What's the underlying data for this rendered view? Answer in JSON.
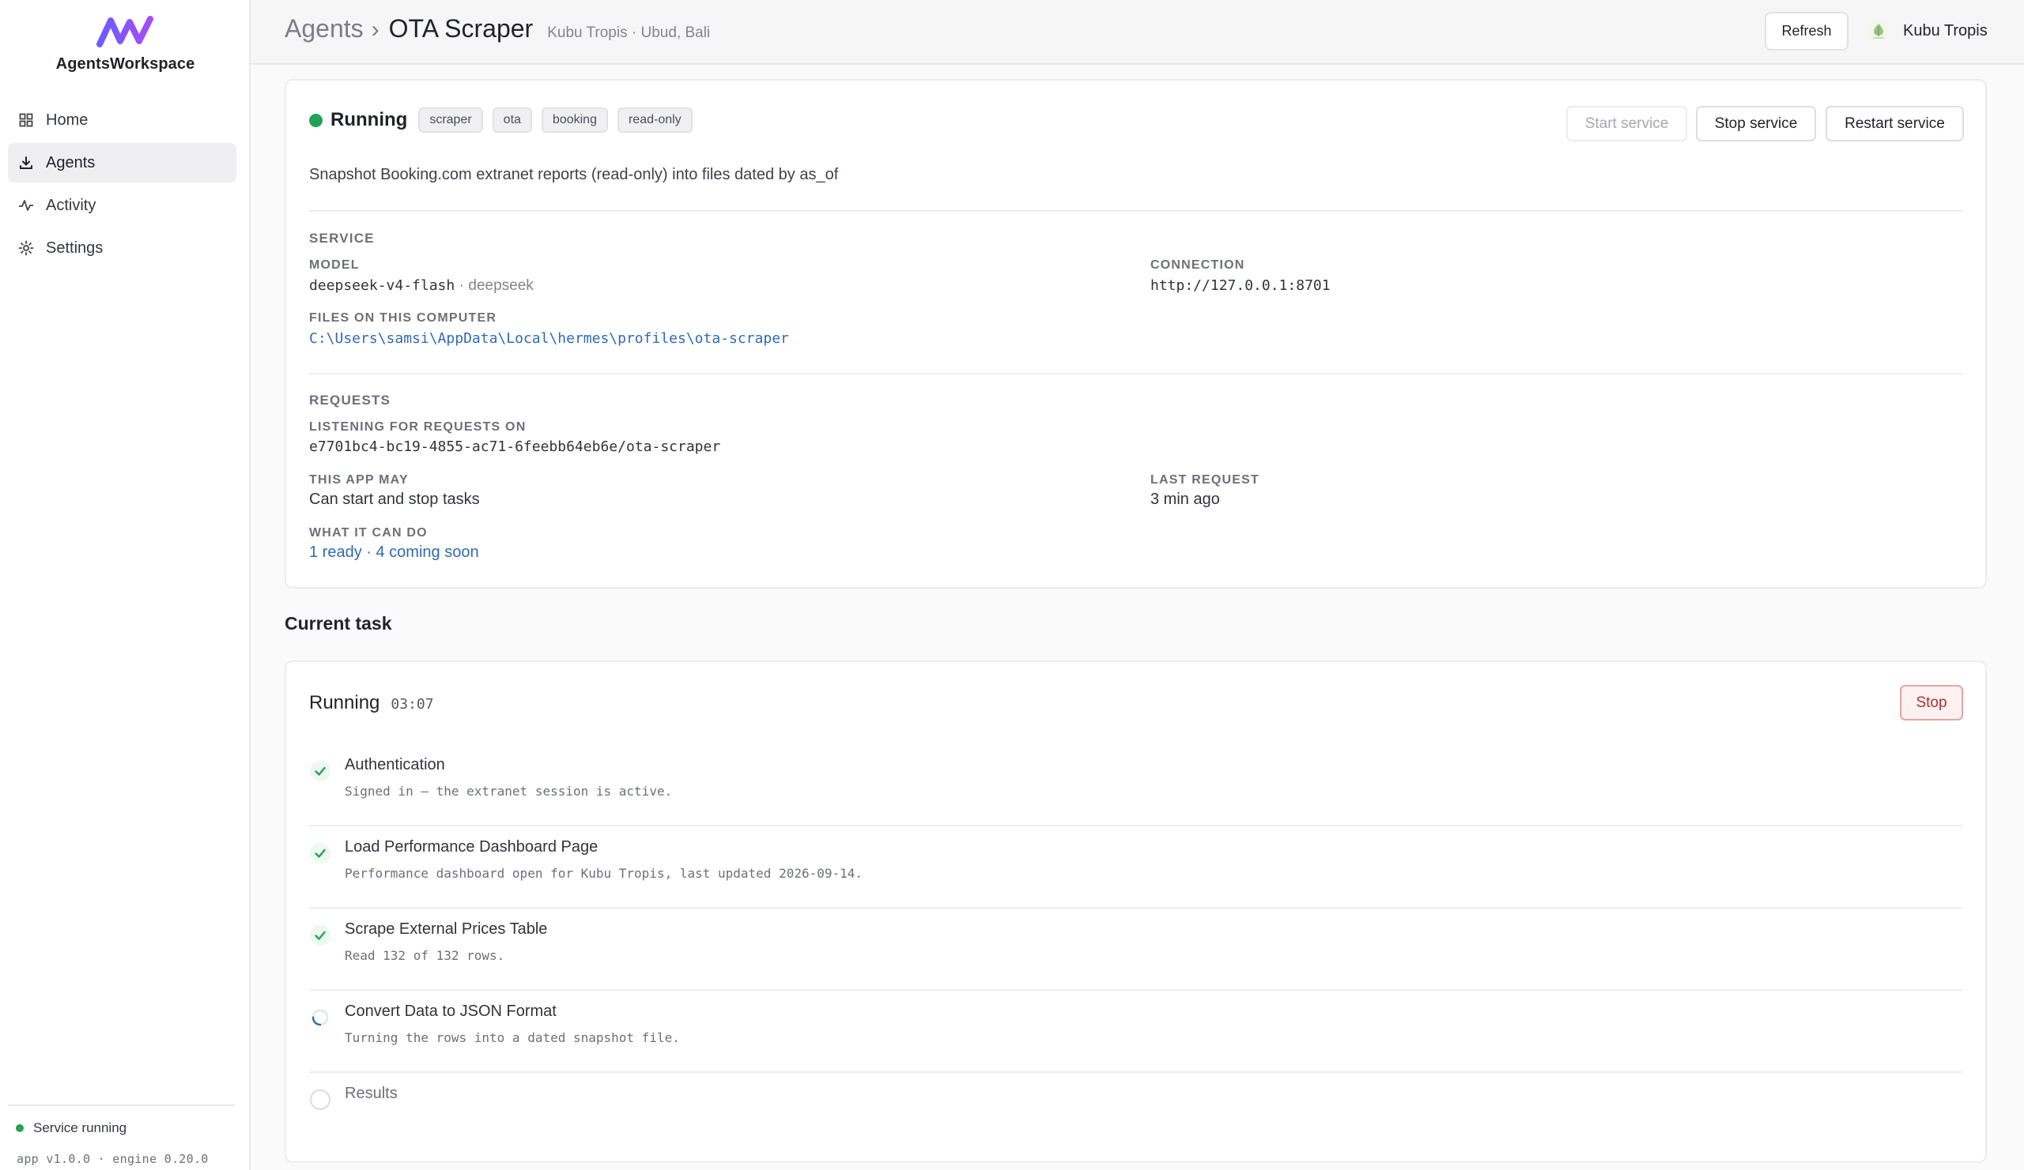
{
  "app": {
    "name": "AgentsWorkspace"
  },
  "nav": {
    "items": [
      {
        "label": "Home",
        "icon": "grid-icon",
        "active": false
      },
      {
        "label": "Agents",
        "icon": "download-icon",
        "active": true
      },
      {
        "label": "Activity",
        "icon": "pulse-icon",
        "active": false
      },
      {
        "label": "Settings",
        "icon": "gear-icon",
        "active": false
      }
    ]
  },
  "sidebar_footer": {
    "service_status": "Service running",
    "version": "app v1.0.0 · engine 0.20.0"
  },
  "header": {
    "breadcrumb_root": "Agents",
    "breadcrumb_sep": "›",
    "title": "OTA Scraper",
    "subtitle": "Kubu Tropis · Ubud, Bali",
    "refresh_label": "Refresh",
    "account_name": "Kubu Tropis"
  },
  "service": {
    "status": "Running",
    "tags": [
      "scraper",
      "ota",
      "booking",
      "read-only"
    ],
    "start_label": "Start service",
    "stop_label": "Stop service",
    "restart_label": "Restart service",
    "description": "Snapshot Booking.com extranet reports (read-only) into files dated by as_of",
    "service_section": "SERVICE",
    "model_label": "MODEL",
    "model_value": "deepseek-v4-flash",
    "model_provider": "· deepseek",
    "connection_label": "CONNECTION",
    "connection_value": "http://127.0.0.1:8701",
    "files_label": "FILES ON THIS COMPUTER",
    "files_value": "C:\\Users\\samsi\\AppData\\Local\\hermes\\profiles\\ota-scraper",
    "requests_section": "REQUESTS",
    "listening_label": "LISTENING FOR REQUESTS ON",
    "listening_value": "e7701bc4-bc19-4855-ac71-6feebb64eb6e/ota-scraper",
    "app_may_label": "THIS APP MAY",
    "app_may_value": "Can start and stop tasks",
    "last_request_label": "LAST REQUEST",
    "last_request_value": "3 min ago",
    "can_do_label": "WHAT IT CAN DO",
    "can_do_value": "1 ready · 4 coming soon"
  },
  "task": {
    "section_title": "Current task",
    "status": "Running",
    "timer": "03:07",
    "stop_label": "Stop",
    "steps": [
      {
        "name": "Authentication",
        "detail": "Signed in — the extranet session is active.",
        "state": "done"
      },
      {
        "name": "Load Performance Dashboard Page",
        "detail": "Performance dashboard open for Kubu Tropis, last updated 2026-09-14.",
        "state": "done"
      },
      {
        "name": "Scrape External Prices Table",
        "detail": "Read 132 of 132 rows.",
        "state": "done"
      },
      {
        "name": "Convert Data to JSON Format",
        "detail": "Turning the rows into a dated snapshot file.",
        "state": "in-progress"
      },
      {
        "name": "Results",
        "detail": "",
        "state": "pending"
      }
    ]
  },
  "colors": {
    "brand": "#7c4dff",
    "running": "#22a356",
    "link": "#2f6bb5",
    "stop": "#b03030"
  }
}
